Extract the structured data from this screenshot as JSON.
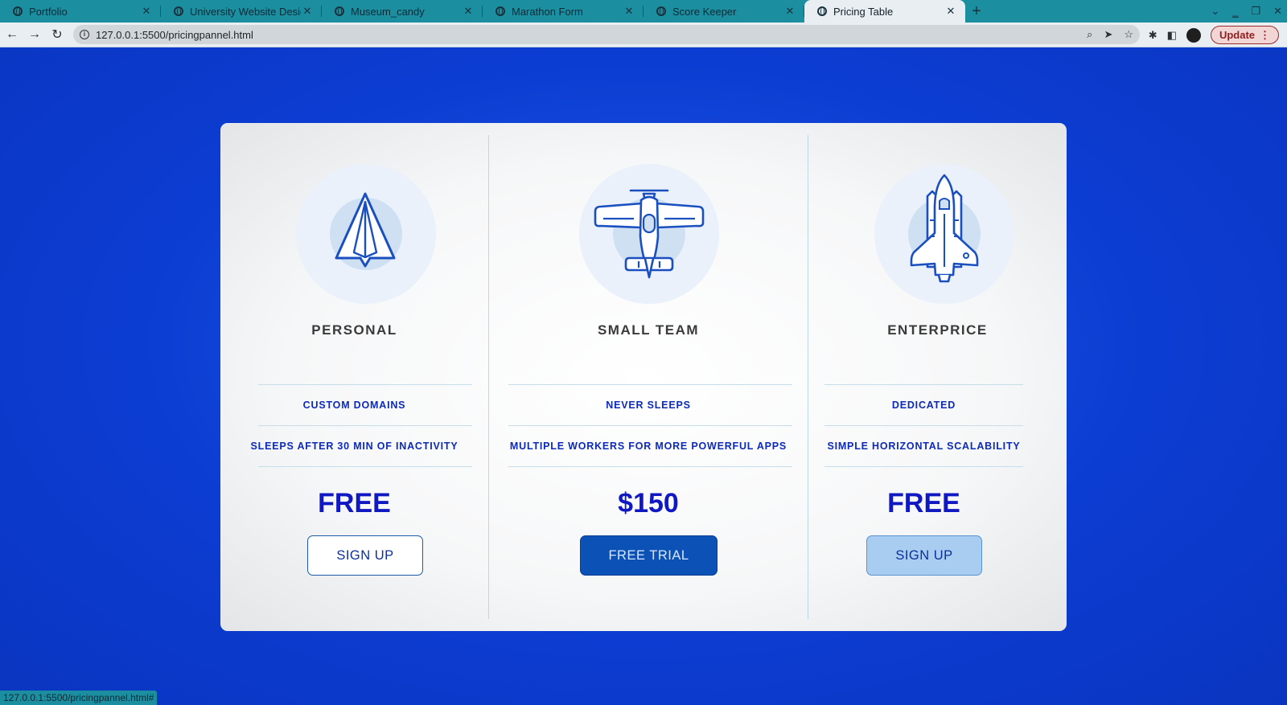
{
  "browser": {
    "tabs": [
      {
        "title": "Portfolio"
      },
      {
        "title": "University Website Design"
      },
      {
        "title": "Museum_candy"
      },
      {
        "title": "Marathon Form"
      },
      {
        "title": "Score Keeper"
      },
      {
        "title": "Pricing Table",
        "active": true
      }
    ],
    "new_tab": "+",
    "url": "127.0.0.1:5500/pricingpannel.html",
    "update_label": "Update",
    "status_url": "127.0.0.1:5500/pricingpannel.html#"
  },
  "colors": {
    "page_bg": "#0c3dd2",
    "panel_bg": "#f6f7f8",
    "accent": "#0c52b6",
    "feature_text": "#0d2ab8",
    "price_text": "#1018c2"
  },
  "plans": [
    {
      "icon": "paper-plane-icon",
      "name": "PERSONAL",
      "features": [
        "CUSTOM DOMAINS",
        "SLEEPS AFTER 30 MIN OF INACTIVITY"
      ],
      "price": "FREE",
      "button": "SIGN UP"
    },
    {
      "icon": "airplane-icon",
      "name": "SMALL TEAM",
      "features": [
        "NEVER SLEEPS",
        "MULTIPLE WORKERS FOR MORE POWERFUL APPS"
      ],
      "price": "$150",
      "button": "FREE TRIAL"
    },
    {
      "icon": "space-shuttle-icon",
      "name": "ENTERPRICE",
      "features": [
        "DEDICATED",
        "SIMPLE HORIZONTAL SCALABILITY"
      ],
      "price": "FREE",
      "button": "SIGN UP"
    }
  ]
}
